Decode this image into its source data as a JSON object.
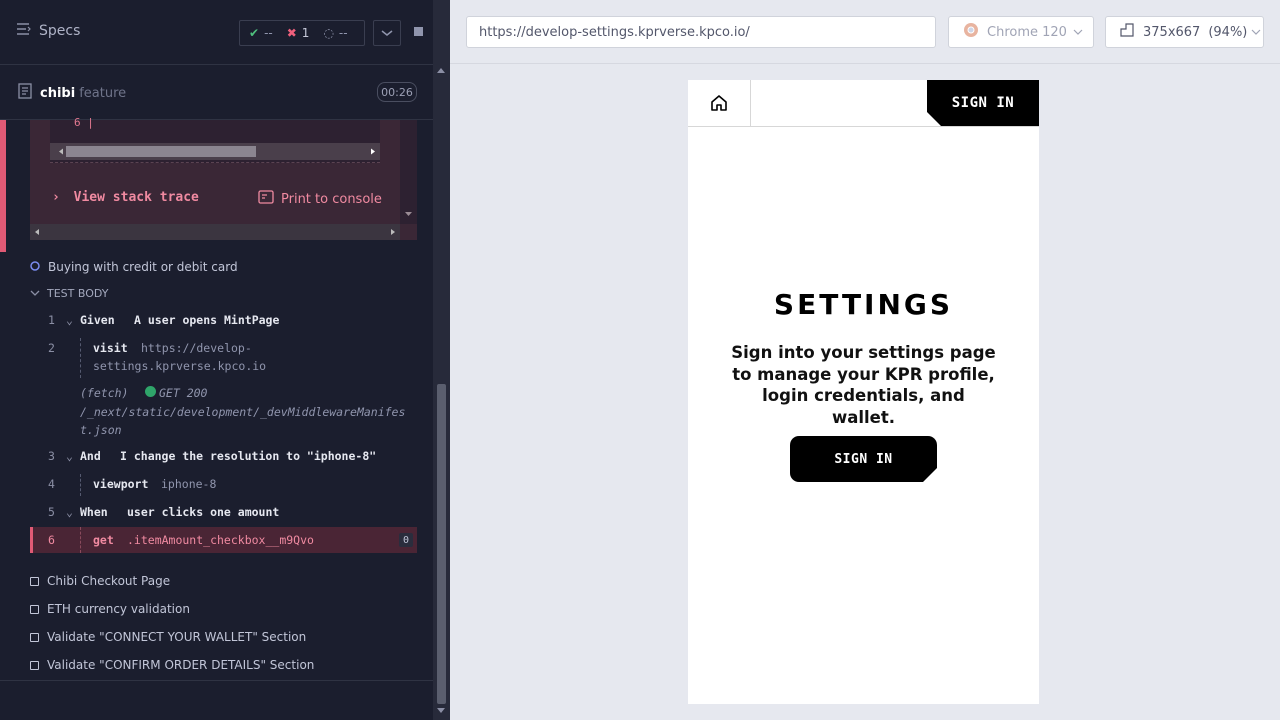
{
  "header": {
    "specs_label": "Specs",
    "passed": "--",
    "failed": "1",
    "pending": "--"
  },
  "spec": {
    "name": "chibi",
    "suffix": "feature",
    "time": "00:26"
  },
  "error": {
    "line": "6 |",
    "stack_trace": "View stack trace",
    "print": "Print to console"
  },
  "current_test": {
    "title": "Buying with credit or debit card",
    "body_label": "TEST BODY",
    "commands": [
      {
        "num": "1",
        "kw": "Given",
        "text": "A user opens MintPage"
      },
      {
        "num": "2",
        "kw": "visit",
        "text": "https://develop-",
        "text2": "settings.kprverse.kpco.io"
      },
      {
        "fetch": "(fetch)",
        "method": "GET 200",
        "path1": "/_next/static/development/_devMiddlewareManifes",
        "path2": "t.json"
      },
      {
        "num": "3",
        "kw": "And",
        "text": "I change the resolution to \"iphone-8\""
      },
      {
        "num": "4",
        "kw": "viewport",
        "text": "iphone-8"
      },
      {
        "num": "5",
        "kw": "When",
        "text": "user clicks one amount"
      },
      {
        "num": "6",
        "kw": "get",
        "text": ".itemAmount_checkbox__m9Qvo",
        "badge": "0"
      }
    ]
  },
  "other_tests": [
    "Chibi Checkout Page",
    "ETH currency validation",
    "Validate \"CONNECT YOUR WALLET\" Section",
    "Validate \"CONFIRM ORDER DETAILS\" Section"
  ],
  "browser": {
    "url": "https://develop-settings.kprverse.kpco.io/",
    "browser_name": "Chrome 120",
    "viewport": "375x667",
    "scale": "(94%)"
  },
  "app": {
    "signin_top": "SIGN IN",
    "title": "SETTINGS",
    "description": "Sign into your settings page to manage your KPR profile, login credentials, and wallet.",
    "signin_button": "SIGN IN"
  }
}
